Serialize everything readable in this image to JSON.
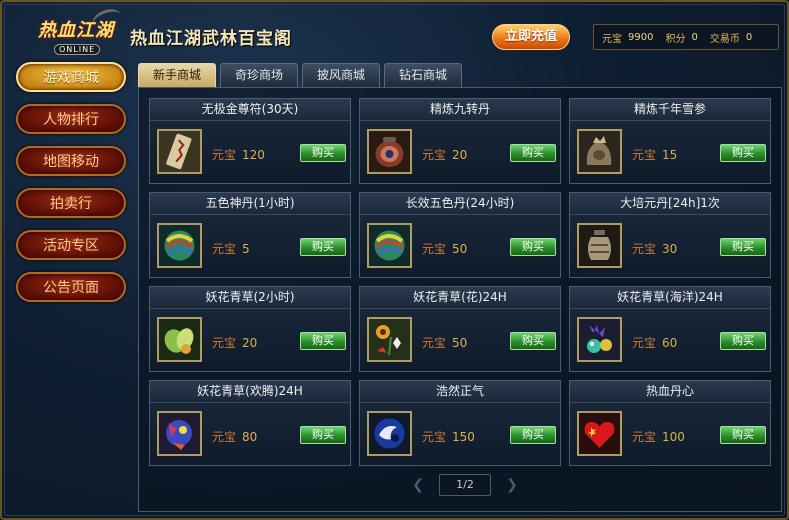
{
  "header": {
    "logo_text": "热血江湖",
    "logo_sub": "ONLINE",
    "title": "热血江湖武林百宝阁",
    "recharge_label": "立即充值",
    "balance": [
      {
        "label": "元宝",
        "value": "9900"
      },
      {
        "label": "积分",
        "value": "0"
      },
      {
        "label": "交易币",
        "value": "0"
      }
    ]
  },
  "sidebar": {
    "items": [
      {
        "label": "游戏商城",
        "active": true
      },
      {
        "label": "人物排行",
        "active": false
      },
      {
        "label": "地图移动",
        "active": false
      },
      {
        "label": "拍卖行",
        "active": false
      },
      {
        "label": "活动专区",
        "active": false
      },
      {
        "label": "公告页面",
        "active": false
      }
    ]
  },
  "tabs": [
    {
      "label": "新手商城",
      "active": true
    },
    {
      "label": "奇珍商场",
      "active": false
    },
    {
      "label": "披风商城",
      "active": false
    },
    {
      "label": "钻石商城",
      "active": false
    }
  ],
  "shop": {
    "currency": "元宝",
    "buy_label": "购买",
    "items": [
      {
        "name": "无极金尊符(30天)",
        "price": "120",
        "icon": "scroll-icon"
      },
      {
        "name": "精炼九转丹",
        "price": "20",
        "icon": "pill-jar-icon"
      },
      {
        "name": "精炼千年雪参",
        "price": "15",
        "icon": "ginseng-bag-icon"
      },
      {
        "name": "五色神丹(1小时)",
        "price": "5",
        "icon": "rainbow-orb-icon"
      },
      {
        "name": "长效五色丹(24小时)",
        "price": "50",
        "icon": "rainbow-orb-icon"
      },
      {
        "name": "大培元丹[24h]1次",
        "price": "30",
        "icon": "urn-icon"
      },
      {
        "name": "妖花青草(2小时)",
        "price": "20",
        "icon": "herb-bundle-icon"
      },
      {
        "name": "妖花青草(花)24H",
        "price": "50",
        "icon": "flower-icon"
      },
      {
        "name": "妖花青草(海洋)24H",
        "price": "60",
        "icon": "sea-creature-icon"
      },
      {
        "name": "妖花青草(欢腾)24H",
        "price": "80",
        "icon": "festive-creature-icon"
      },
      {
        "name": "浩然正气",
        "price": "150",
        "icon": "swirl-orb-icon"
      },
      {
        "name": "热血丹心",
        "price": "100",
        "icon": "red-heart-icon"
      }
    ]
  },
  "pager": {
    "text": "1/2"
  },
  "colors": {
    "accent_gold": "#f4c447",
    "buy_green": "#2c8f2c",
    "price_gold": "#d9b04a"
  }
}
